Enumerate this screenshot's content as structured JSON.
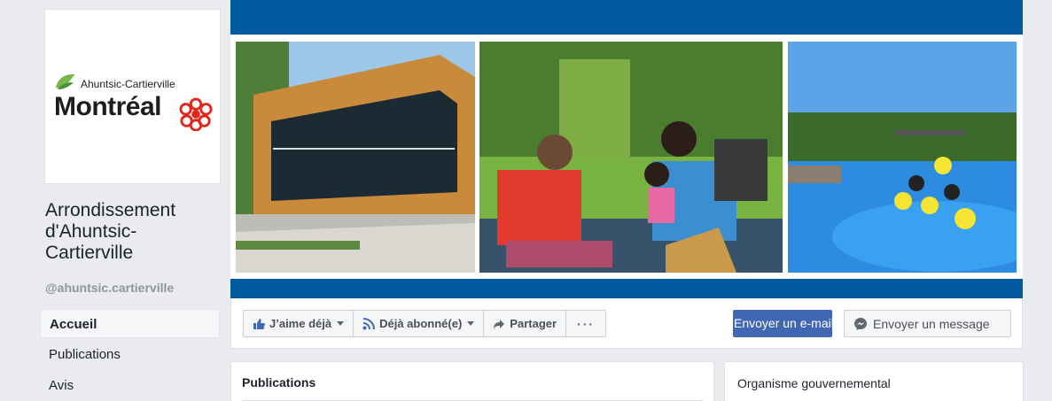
{
  "logo": {
    "subtitle": "Ahuntsic-Cartierville",
    "title": "Montréal"
  },
  "page": {
    "name": "Arrondissement d'Ahuntsic-Cartierville",
    "handle": "@ahuntsic.cartierville"
  },
  "nav": {
    "items": [
      {
        "label": "Accueil",
        "active": true
      },
      {
        "label": "Publications"
      },
      {
        "label": "Avis"
      }
    ]
  },
  "actions": {
    "like_label": "J’aime déjà",
    "follow_label": "Déjà abonné(e)",
    "share_label": "Partager",
    "more_label": "···",
    "email_label": "Envoyer un e-mail",
    "message_label": "Envoyer un message"
  },
  "cards": {
    "publications_title": "Publications",
    "category": "Organisme gouvernemental"
  },
  "colors": {
    "brand_blue": "#005aa0",
    "fb_blue": "#4267b2",
    "montreal_red": "#e1261c"
  }
}
